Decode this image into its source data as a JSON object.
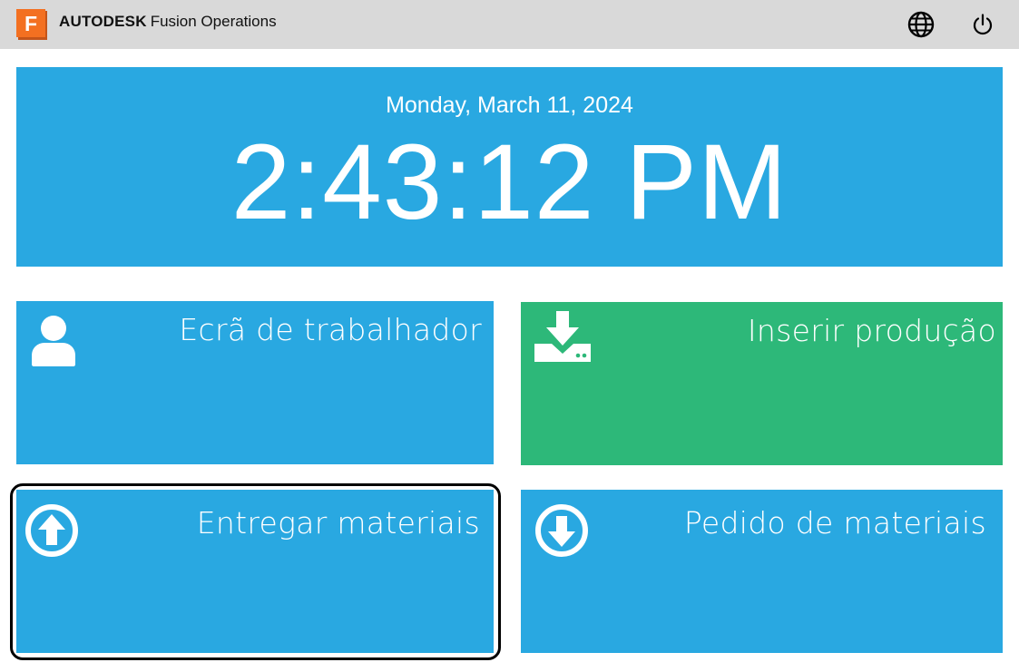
{
  "header": {
    "logo_letter": "F",
    "brand_strong": "AUTODESK",
    "brand_light": "Fusion Operations",
    "globe_icon": "globe-icon",
    "power_icon": "power-icon"
  },
  "clock": {
    "date": "Monday, March 11, 2024",
    "time": "2:43:12 PM"
  },
  "tiles": [
    {
      "label": "Ecrã de trabalhador",
      "icon": "user-icon",
      "color": "#29a8e1"
    },
    {
      "label": "Inserir produção",
      "icon": "download-tray-icon",
      "color": "#2db879"
    },
    {
      "label": "Entregar materiais",
      "icon": "arrow-up-circle-icon",
      "color": "#29a8e1",
      "focused": true
    },
    {
      "label": "Pedido de materiais",
      "icon": "arrow-down-circle-icon",
      "color": "#29a8e1"
    }
  ],
  "colors": {
    "topbar": "#d9d9d9",
    "accent_blue": "#29a8e1",
    "accent_green": "#2db879",
    "logo_orange": "#f37021"
  }
}
